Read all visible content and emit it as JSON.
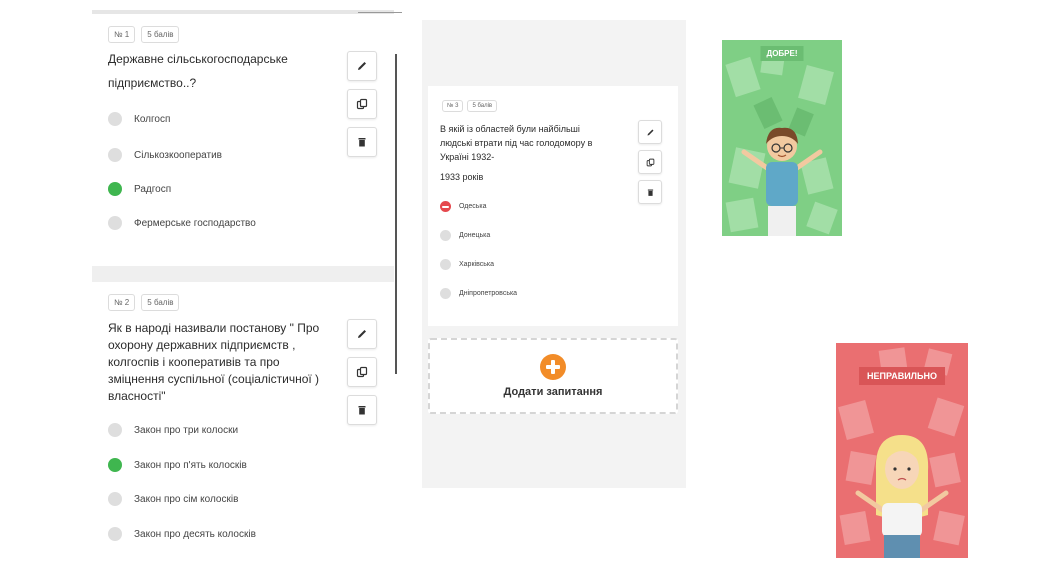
{
  "questions": [
    {
      "number": "№ 1",
      "points": "5 балів",
      "text_lines": [
        "Державне сільськогосподарське",
        "підприємство..?"
      ],
      "options": [
        {
          "label": "Колгосп",
          "state": "unselected"
        },
        {
          "label": "Сількозкооператив",
          "state": "unselected"
        },
        {
          "label": "Радгосп",
          "state": "correct"
        },
        {
          "label": "Фермерське господарство",
          "state": "unselected"
        }
      ]
    },
    {
      "number": "№ 2",
      "points": "5 балів",
      "text_lines": [
        "Як в народі називали постанову \" Про",
        "охорону державних підприємств ,",
        "колгоспів і кооперативів та про",
        "зміцнення суспільної (соціалістичної )",
        "власності\""
      ],
      "options": [
        {
          "label": "Закон про три колоски",
          "state": "unselected"
        },
        {
          "label": "Закон про п'ять колосків",
          "state": "correct"
        },
        {
          "label": "Закон про сім колосків",
          "state": "unselected"
        },
        {
          "label": "Закон про десять колосків",
          "state": "unselected"
        }
      ]
    },
    {
      "number": "№ 3",
      "points": "5 балів",
      "text_lines": [
        "В якій із областей були найбільші",
        "людські втрати під час голодомору в",
        "Україні 1932-",
        "1933 років"
      ],
      "options": [
        {
          "label": "Одеська",
          "state": "wrong"
        },
        {
          "label": "Донецька",
          "state": "unselected"
        },
        {
          "label": "Харківська",
          "state": "unselected"
        },
        {
          "label": "Дніпропетровська",
          "state": "unselected"
        }
      ]
    }
  ],
  "tools": {
    "edit": "pencil-icon",
    "duplicate": "copy-icon",
    "delete": "trash-icon"
  },
  "add_question": {
    "label": "Додати запитання"
  },
  "feedback": {
    "good": {
      "label": "ДОБРЕ!",
      "color": "#7fcf85"
    },
    "bad": {
      "label": "НЕПРАВИЛЬНО",
      "color": "#ea6f71"
    }
  },
  "colors": {
    "correct": "#3fb64f",
    "wrong": "#e5484d",
    "accent": "#f28c28"
  }
}
